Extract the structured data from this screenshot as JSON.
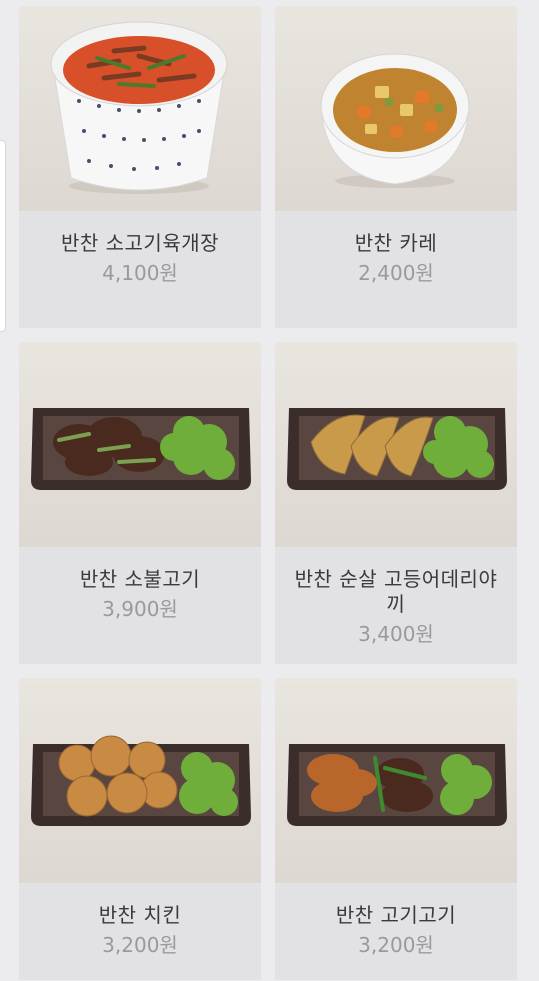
{
  "products": [
    {
      "name": "반찬 소고기육개장",
      "price": "4,100원",
      "image": "beef-yukgaejang-bowl"
    },
    {
      "name": "반찬 카레",
      "price": "2,400원",
      "image": "curry-bowl"
    },
    {
      "name": "반찬 소불고기",
      "price": "3,900원",
      "image": "beef-bulgogi-tray"
    },
    {
      "name": "반찬 순살 고등어데리야끼",
      "price": "3,400원",
      "image": "mackerel-teriyaki-tray"
    },
    {
      "name": "반찬 치킨",
      "price": "3,200원",
      "image": "chicken-tray"
    },
    {
      "name": "반찬 고기고기",
      "price": "3,200원",
      "image": "mixed-meat-tray"
    }
  ]
}
